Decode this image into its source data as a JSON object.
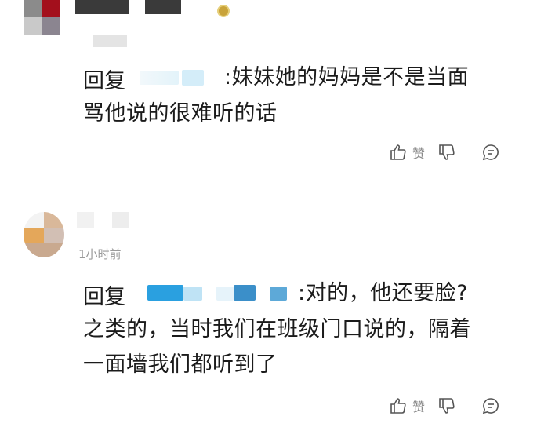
{
  "comment1": {
    "reply_prefix": "回复",
    "reply_text": ":妹妹她的妈妈是不是当面",
    "reply_text_line2": "骂他说的很难听的话",
    "like_label": "赞"
  },
  "comment2": {
    "time": "1小时前",
    "reply_prefix": "回复",
    "reply_text_line1": ":对的，他还要脸?",
    "reply_text_line2": "之类的，当时我们在班级门口说的，隔着",
    "reply_text_line3": "一面墙我们都听到了",
    "like_label": "赞"
  },
  "icons": [
    "thumbs-up-icon",
    "thumbs-down-icon",
    "comment-icon",
    "badge-icon"
  ]
}
